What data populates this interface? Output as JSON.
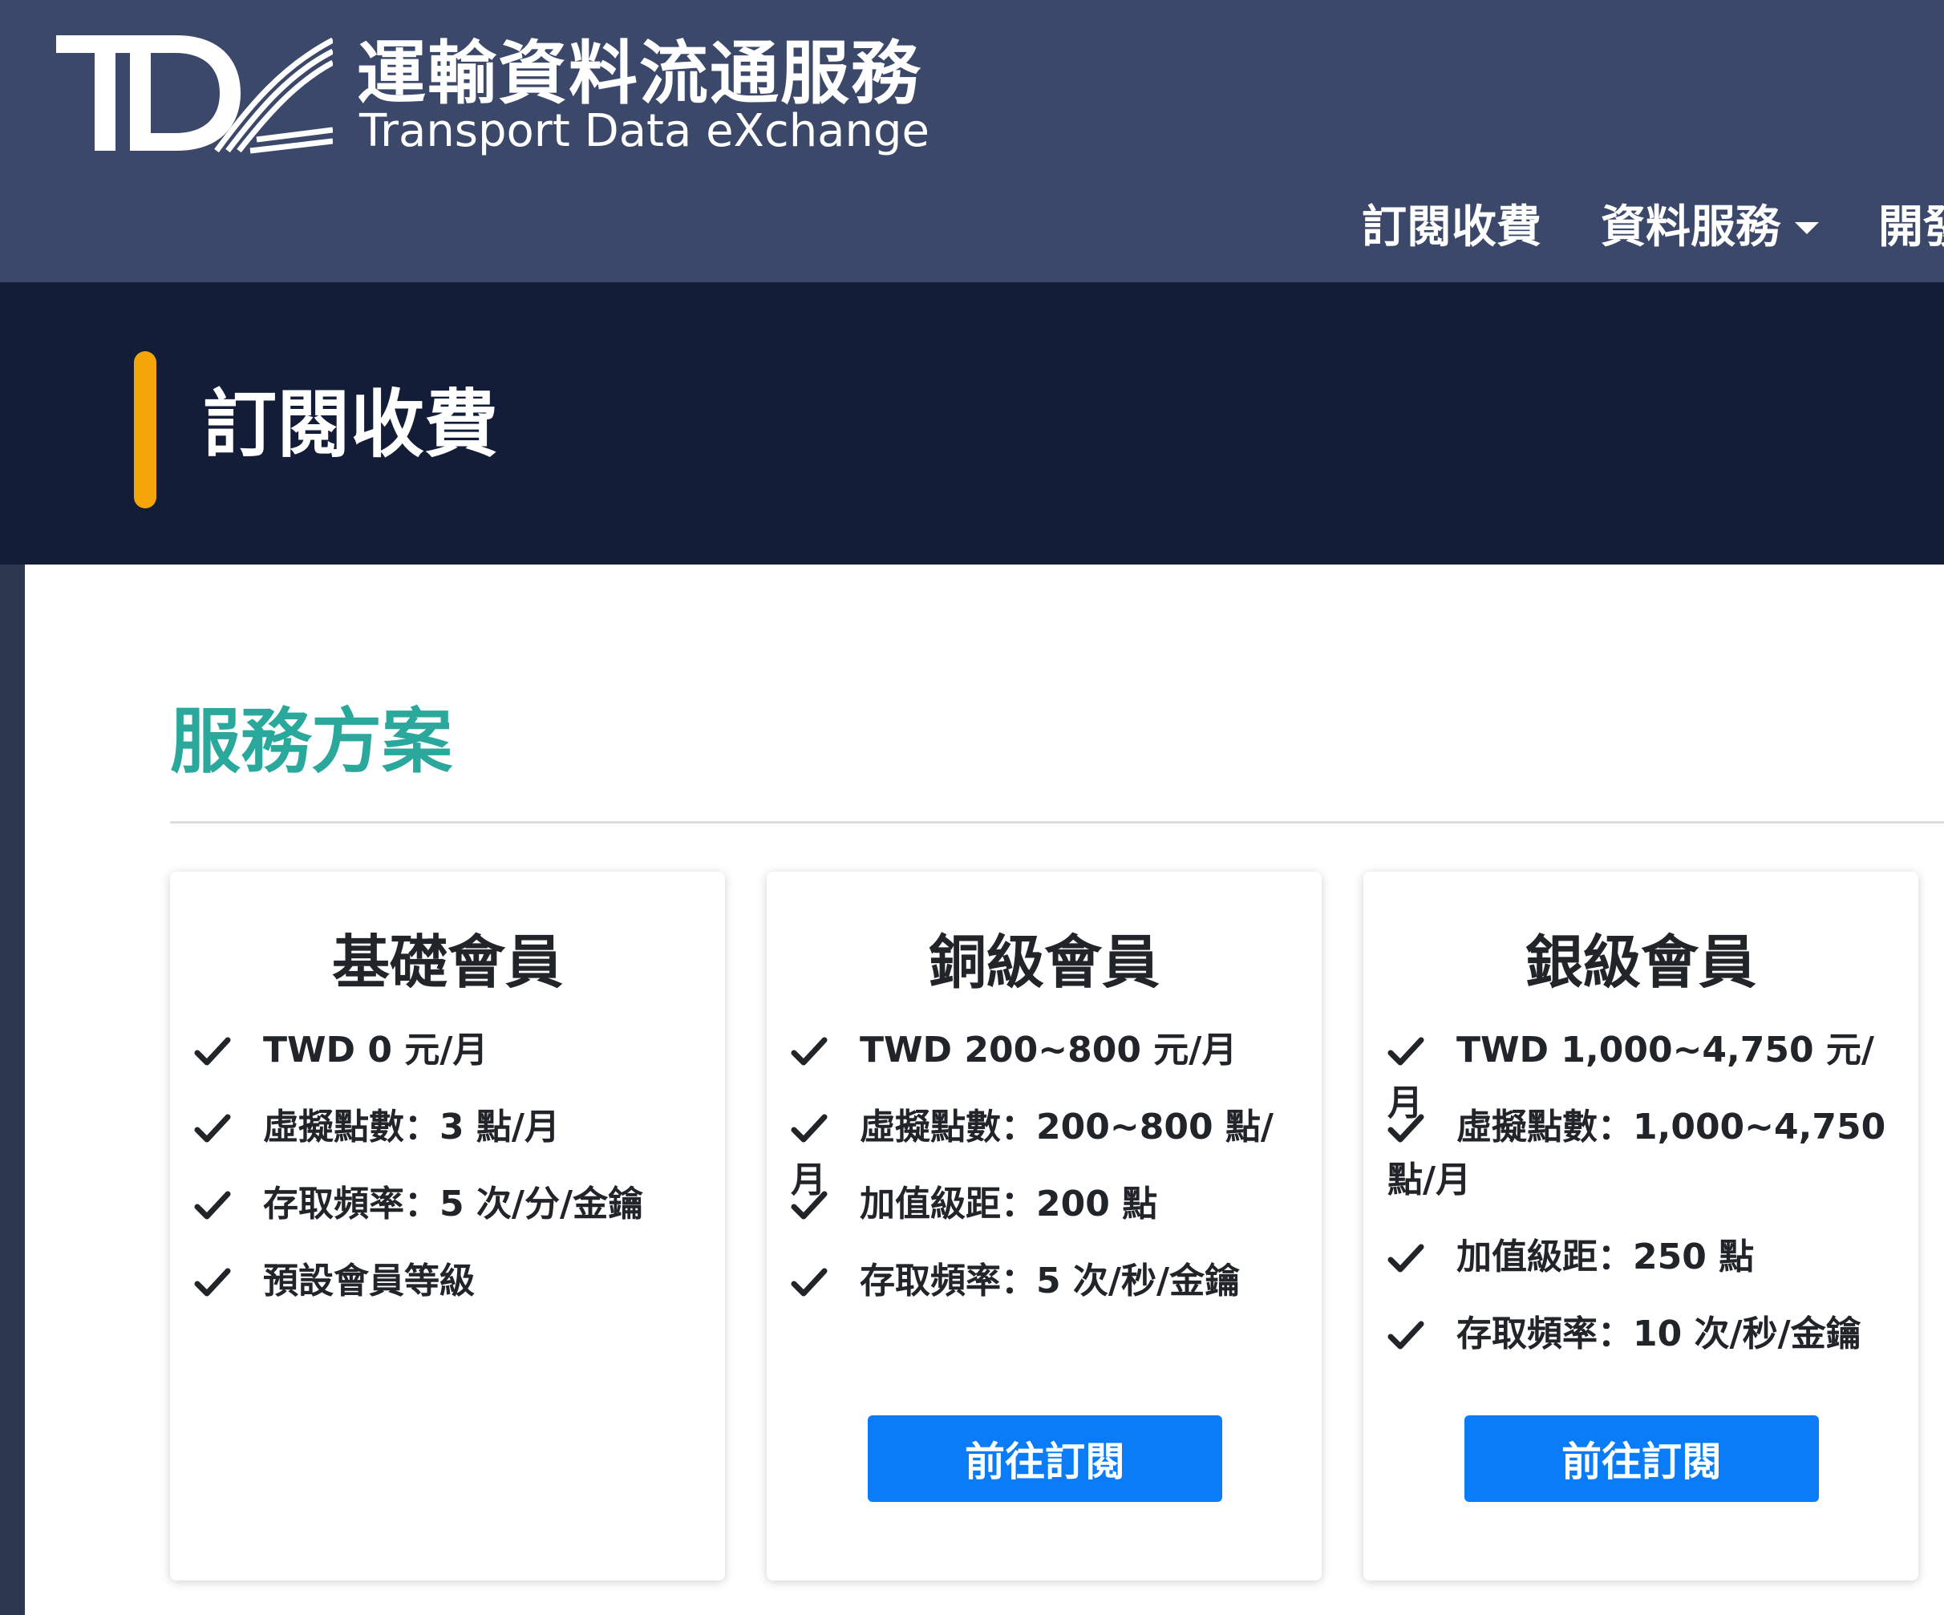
{
  "header": {
    "logo_mark": "TDX",
    "logo_zh": "運輸資料流通服務",
    "logo_en": "Transport Data eXchange",
    "nav": [
      {
        "label": "訂閱收費"
      },
      {
        "label": "資料服務"
      },
      {
        "label": "開發"
      }
    ]
  },
  "page": {
    "title": "訂閱收費",
    "section_title": "服務方案"
  },
  "plans": [
    {
      "name": "基礎會員",
      "features": [
        "TWD 0 元/月",
        "虛擬點數：3 點/月",
        "存取頻率：5 次/分/金鑰",
        "預設會員等級"
      ],
      "button": ""
    },
    {
      "name": "銅級會員",
      "features": [
        "TWD 200~800 元/月",
        "虛擬點數：200~800 點/月",
        "加值級距：200 點",
        "存取頻率：5 次/秒/金鑰"
      ],
      "button": "前往訂閱"
    },
    {
      "name": "銀級會員",
      "features": [
        "TWD 1,000~4,750 元/月",
        "虛擬點數：1,000~4,750 點/月",
        "加值級距：250 點",
        "存取頻率：10 次/秒/金鑰"
      ],
      "button": "前往訂閱"
    }
  ],
  "colors": {
    "header_bg": "#3b4869",
    "title_band_bg": "#141d38",
    "accent": "#f4a609",
    "section_title": "#2aa89b",
    "button_bg": "#0a7cf7"
  }
}
